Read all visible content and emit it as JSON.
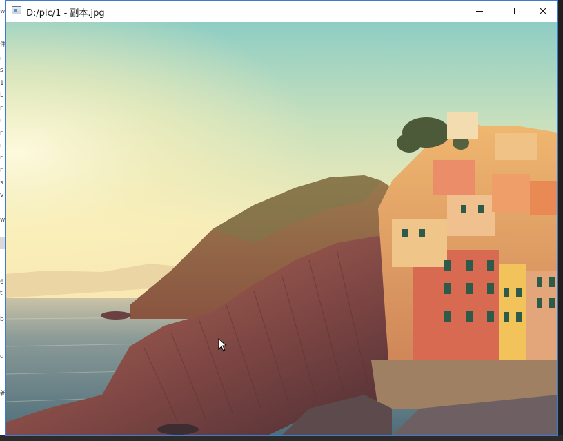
{
  "window": {
    "title": "D:/pic/1 - 副本.jpg",
    "controls": {
      "minimize": "minimize-icon",
      "maximize": "maximize-icon",
      "close": "close-icon"
    }
  },
  "background_window_glyphs": [
    "w",
    "件",
    "n",
    "s",
    "1",
    "L",
    "r",
    "r",
    "r",
    "r",
    "r",
    "r",
    "s",
    "v",
    "w",
    "6",
    "t",
    "b",
    "d",
    "新"
  ],
  "image": {
    "description_colors": {
      "sky_top": "#78c2bf",
      "sky_glow": "#fdf1b6",
      "sea": "#6f8b93",
      "cliff": "#8a4d45",
      "houses": "#e49e5a"
    }
  }
}
